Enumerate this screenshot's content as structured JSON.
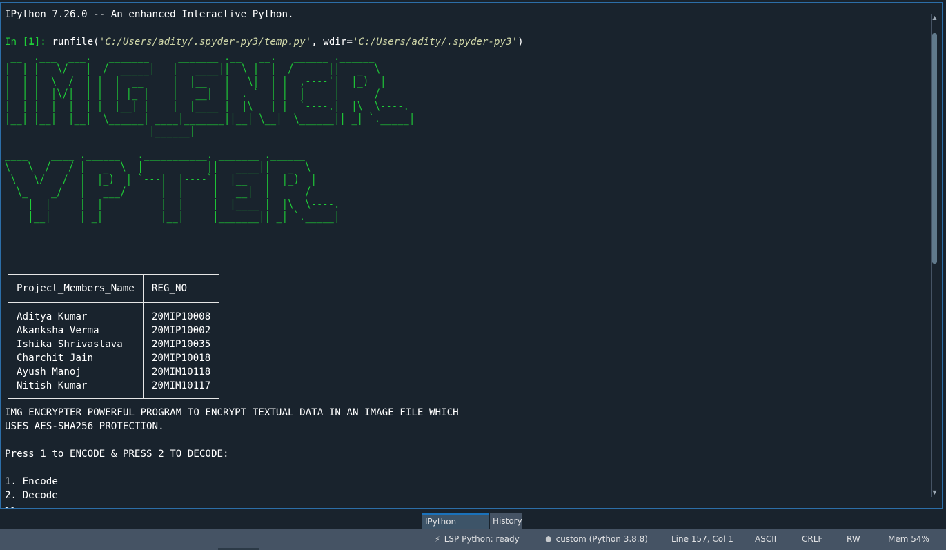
{
  "console": {
    "banner": "IPython 7.26.0 -- An enhanced Interactive Python.",
    "prompt_label": "In [",
    "prompt_number": "1",
    "prompt_suffix": "]:",
    "command_func": " runfile(",
    "command_arg1": "'C:/Users/adity/.spyder-py3/temp.py'",
    "command_mid": ", wdir=",
    "command_arg2": "'C:/Users/adity/.spyder-py3'",
    "command_end": ")",
    "ascii_art_1": " __  .___  ___.   _______     _______ .__   __.   ______ .______   \n|  | |   \\/   |  /  _____|   |   ____||  \\ |  |  /      ||   _  \\  \n|  | |  \\  /  | |  |  __     |  |__   |   \\|  | |  ,----'|  |_)  | \n|  | |  |\\/|  | |  | |_ |    |   __|  |  . `  | |  |     |      /  \n|  | |  |  |  | |  |__| |    |  |____ |  |\\   | |  `----.|  |\\  \\----.\n|__| |__|  |__|  \\______| ____|_______||__| \\__|  \\______|| _| `._____|\n                         |______|",
    "ascii_art_2": "____    ____ .______   .___________. _______ .______      \n\\   \\  /   / |   _  \\  |           ||   ____||   _  \\     \n \\   \\/   /  |  |_)  | `---|  |----`|  |__   |  |_)  |    \n  \\_    _/   |   ___/      |  |     |   __|  |      /     \n    |  |     |  |          |  |     |  |____ |  |\\  \\----.\n    |__|     | _|          |__|     |_______|| _| `._____|",
    "table": {
      "headers": [
        "Project_Members_Name",
        "REG_NO"
      ],
      "rows": [
        [
          "Aditya Kumar",
          "20MIP10008"
        ],
        [
          "Akanksha Verma",
          "20MIP10002"
        ],
        [
          "Ishika Shrivastava",
          "20MIP10035"
        ],
        [
          "Charchit Jain",
          "20MIP10018"
        ],
        [
          "Ayush Manoj",
          "20MIM10118"
        ],
        [
          "Nitish Kumar",
          "20MIM10117"
        ]
      ]
    },
    "description_line1": "IMG_ENCRYPTER POWERFUL PROGRAM TO ENCRYPT TEXTUAL DATA IN AN IMAGE FILE WHICH",
    "description_line2": "USES AES-SHA256 PROTECTION.",
    "press_instruction": "Press 1 to ENCODE & PRESS 2 TO DECODE:",
    "option_1": "1. Encode",
    "option_2": "2. Decode",
    "input_prompt": ">>"
  },
  "tabs": {
    "ipython_console": "IPython console",
    "history": "History"
  },
  "statusbar": {
    "lsp_icon": "lsp-plug-icon",
    "lsp": "LSP Python: ready",
    "env_icon": "cube-icon",
    "env": "custom (Python 3.8.8)",
    "cursor": "Line 157, Col 1",
    "encoding": "ASCII",
    "eol": "CRLF",
    "permissions": "RW",
    "memory": "Mem 54%"
  },
  "colors": {
    "background": "#19232d",
    "prompt_green": "#1fce38",
    "statusbar": "#455364",
    "accent_border": "#2c6ea8"
  }
}
